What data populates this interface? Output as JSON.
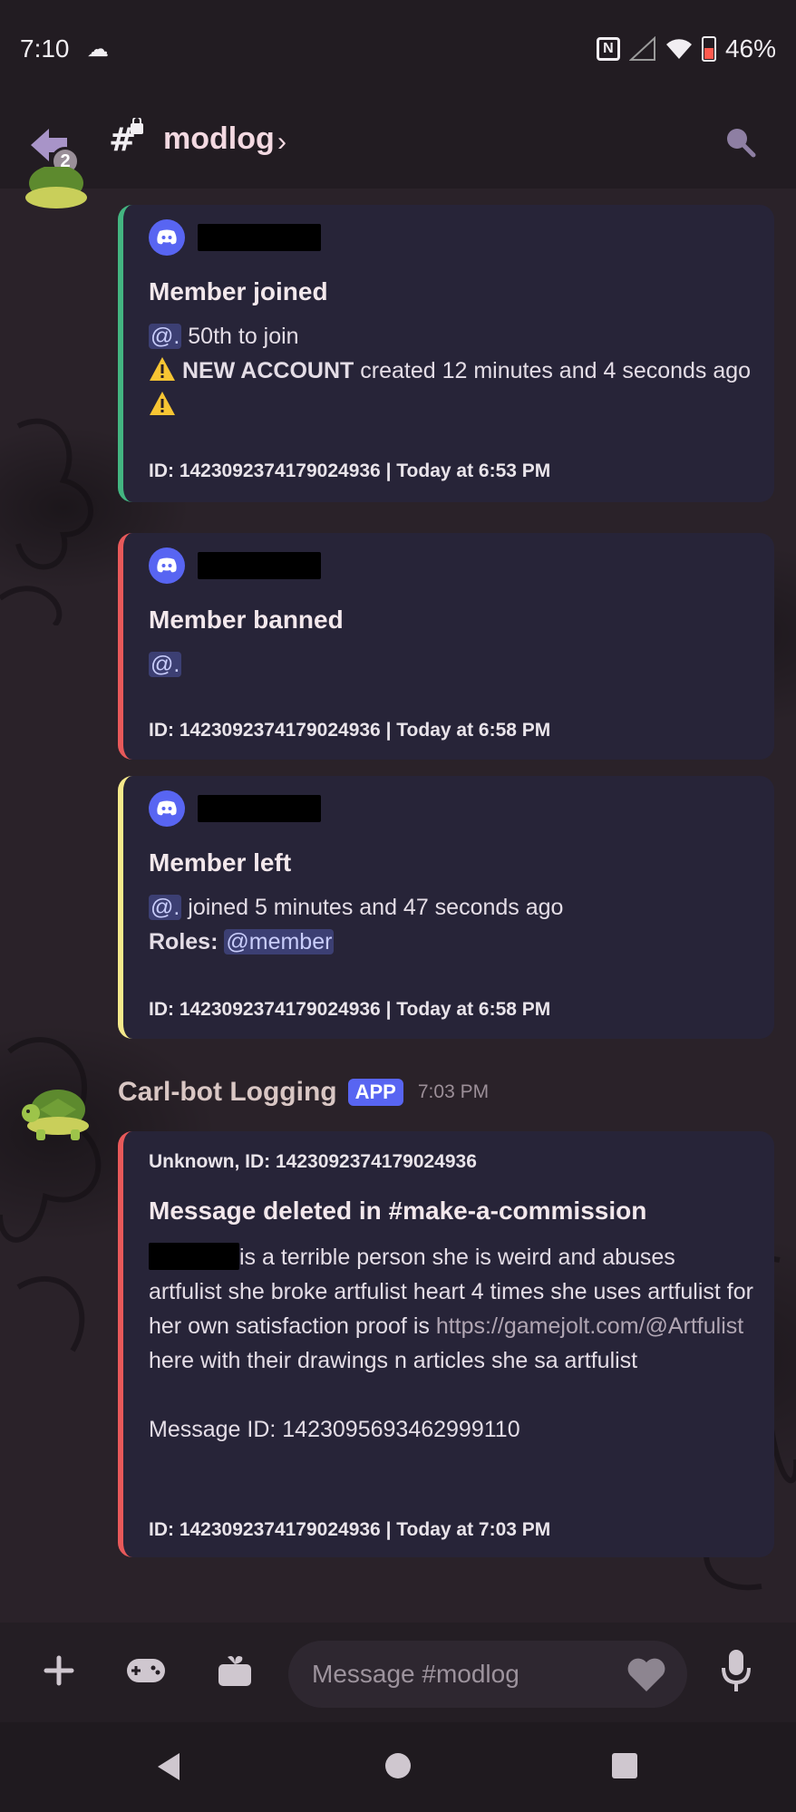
{
  "status_bar": {
    "time": "7:10",
    "battery": "46%"
  },
  "header": {
    "channel_name": "modlog",
    "unread_count": "2"
  },
  "embeds": [
    {
      "title": "Member joined",
      "line1_mention": "@.",
      "line1_text": " 50th to join",
      "line2_bold": "NEW ACCOUNT",
      "line2_text": " created 12 minutes and 4 seconds ago",
      "footer": "ID: 1423092374179024936 | Today at 6:53 PM",
      "color": "#43b581"
    },
    {
      "title": "Member banned",
      "line1_mention": "@.",
      "footer": "ID: 1423092374179024936 | Today at 6:58 PM",
      "color": "#e8595a"
    },
    {
      "title": "Member left",
      "line1_mention": "@.",
      "line1_text": " joined 5 minutes and 47 seconds ago",
      "roles_label": "Roles:",
      "roles_value": "@member",
      "footer": "ID: 1423092374179024936 | Today at 6:58 PM",
      "color": "#f5e98b"
    }
  ],
  "message": {
    "author": "Carl-bot Logging",
    "tag": "APP",
    "time": "7:03 PM",
    "embed": {
      "author_line": "Unknown, ID: 1423092374179024936",
      "title": "Message deleted in #make-a-commission",
      "content_text": "is a terrible person she is weird and abuses artfulist she broke artfulist heart 4 times she uses artfulist for her own satisfaction proof is ",
      "content_link": "https://gamejolt.com/@Artfulist",
      "content_tail": " here with their drawings n articles she sa artfulist",
      "message_id": "Message ID: 1423095693462999110",
      "footer": "ID: 1423092374179024936 | Today at 7:03 PM",
      "color": "#e8595a"
    }
  },
  "composer": {
    "placeholder": "Message #modlog"
  }
}
